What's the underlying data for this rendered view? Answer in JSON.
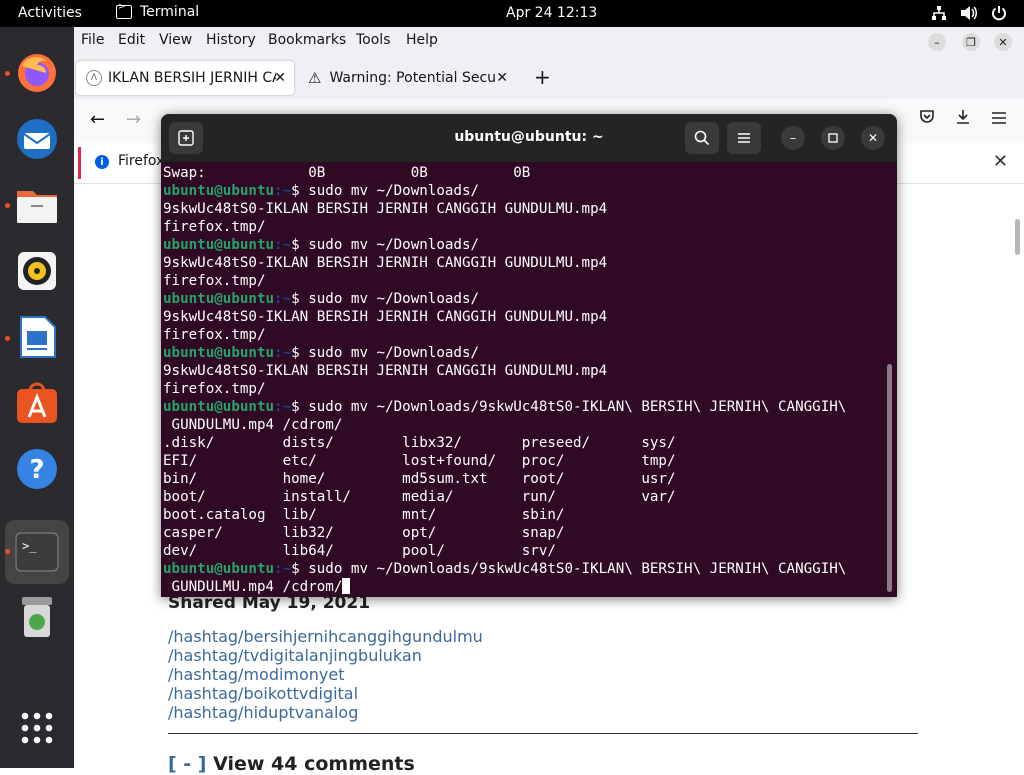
{
  "topbar": {
    "activities": "Activities",
    "app_name": "Terminal",
    "clock": "Apr 24  12:13"
  },
  "dock": {
    "items": [
      "firefox-icon",
      "thunderbird-icon",
      "files-icon",
      "rhythmbox-icon",
      "libreoffice-writer-icon",
      "app-center-icon",
      "help-icon",
      "terminal-icon",
      "trash-icon",
      "show-apps-icon"
    ]
  },
  "firefox": {
    "menu": [
      "File",
      "Edit",
      "View",
      "History",
      "Bookmarks",
      "Tools",
      "Help"
    ],
    "tabs": [
      {
        "title": "IKLAN BERSIH JERNIH CA",
        "close": "✕"
      },
      {
        "title": "Warning: Potential Securi",
        "close": "✕"
      }
    ],
    "new_tab": "+",
    "notice_text": "Firefox",
    "page": {
      "shared": "Shared May 19, 2021",
      "hashtags": [
        "/hashtag/bersihjernihcanggihgundulmu",
        "/hashtag/tvdigitalanjingbulukan",
        "/hashtag/modimonyet",
        "/hashtag/boikottvdigital",
        "/hashtag/hiduptvanalog"
      ],
      "comments_bracket": "[ - ]",
      "comments_label": "View 44 comments"
    }
  },
  "terminal": {
    "title": "ubuntu@ubuntu: ~",
    "prompt_user": "ubuntu@ubuntu",
    "prompt_path": ":~",
    "prompt_sign": "$ ",
    "lines": [
      {
        "text": "Swap:            0B          0B          0B"
      },
      {
        "prompt": true,
        "cmd": "sudo mv ~/Downloads/"
      },
      {
        "text": "9skwUc48tS0-IKLAN BERSIH JERNIH CANGGIH GUNDULMU.mp4"
      },
      {
        "text": "firefox.tmp/"
      },
      {
        "prompt": true,
        "cmd": "sudo mv ~/Downloads/"
      },
      {
        "text": "9skwUc48tS0-IKLAN BERSIH JERNIH CANGGIH GUNDULMU.mp4"
      },
      {
        "text": "firefox.tmp/"
      },
      {
        "prompt": true,
        "cmd": "sudo mv ~/Downloads/"
      },
      {
        "text": "9skwUc48tS0-IKLAN BERSIH JERNIH CANGGIH GUNDULMU.mp4"
      },
      {
        "text": "firefox.tmp/"
      },
      {
        "prompt": true,
        "cmd": "sudo mv ~/Downloads/"
      },
      {
        "text": "9skwUc48tS0-IKLAN BERSIH JERNIH CANGGIH GUNDULMU.mp4"
      },
      {
        "text": "firefox.tmp/"
      },
      {
        "prompt": true,
        "cmd": "sudo mv ~/Downloads/9skwUc48tS0-IKLAN\\ BERSIH\\ JERNIH\\ CANGGIH\\"
      },
      {
        "text": " GUNDULMU.mp4 /cdrom/"
      },
      {
        "text": ".disk/        dists/        libx32/       preseed/      sys/"
      },
      {
        "text": "EFI/          etc/          lost+found/   proc/         tmp/"
      },
      {
        "text": "bin/          home/         md5sum.txt    root/         usr/"
      },
      {
        "text": "boot/         install/      media/        run/          var/"
      },
      {
        "text": "boot.catalog  lib/          mnt/          sbin/"
      },
      {
        "text": "casper/       lib32/        opt/          snap/"
      },
      {
        "text": "dev/          lib64/        pool/         srv/"
      },
      {
        "prompt": true,
        "cmd": "sudo mv ~/Downloads/9skwUc48tS0-IKLAN\\ BERSIH\\ JERNIH\\ CANGGIH\\"
      },
      {
        "text": " GUNDULMU.mp4 /cdrom/",
        "cursor": true
      }
    ]
  },
  "colors": {
    "terminal_bg": "#300a24",
    "prompt_user": "#26a269",
    "prompt_path": "#12488b",
    "accent": "#e95420"
  }
}
